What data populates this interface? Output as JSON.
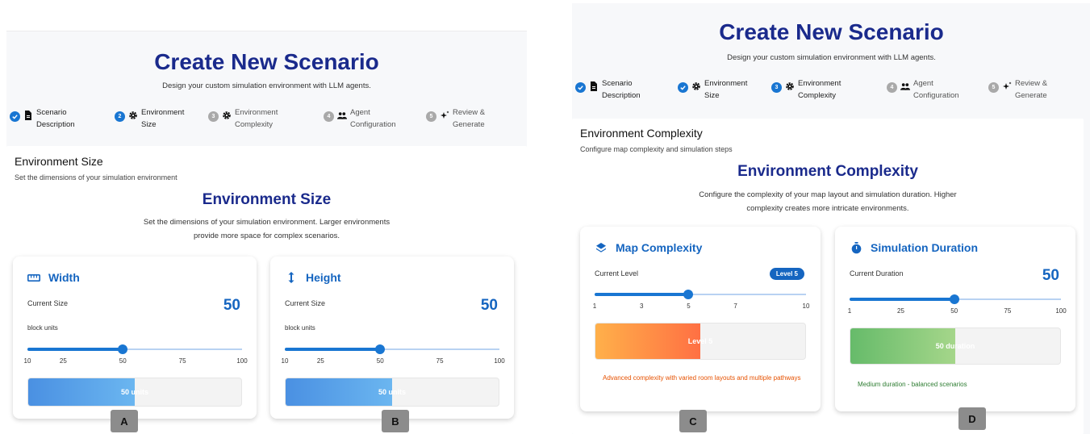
{
  "left": {
    "title": "Create New Scenario",
    "subtitle": "Design your custom simulation environment with LLM agents.",
    "steps": [
      {
        "num": "1",
        "line1": "Scenario",
        "line2": "Description",
        "state": "done",
        "icon": "document-icon"
      },
      {
        "num": "2",
        "line1": "Environment",
        "line2": "Size",
        "state": "active",
        "icon": "gear-icon"
      },
      {
        "num": "3",
        "line1": "Environment",
        "line2": "Complexity",
        "state": "todo",
        "icon": "gear-icon"
      },
      {
        "num": "4",
        "line1": "Agent",
        "line2": "Configuration",
        "state": "todo",
        "icon": "people-icon"
      },
      {
        "num": "5",
        "line1": "Review &",
        "line2": "Generate",
        "state": "todo",
        "icon": "sparkle-icon"
      }
    ],
    "section": {
      "title": "Environment Size",
      "subtitle": "Set the dimensions of your simulation environment"
    },
    "heading": "Environment Size",
    "desc1": "Set the dimensions of your simulation environment. Larger environments",
    "desc2": "provide more space for complex scenarios.",
    "width": {
      "title": "Width",
      "label": "Current Size",
      "value": "50",
      "unit": "block units",
      "slider": {
        "min": 10,
        "max": 100,
        "value": 50
      },
      "ticks": [
        "10",
        "25",
        "50",
        "75",
        "100"
      ],
      "bar_text": "50 units",
      "bar_fraction": 0.5
    },
    "height": {
      "title": "Height",
      "label": "Current Size",
      "value": "50",
      "unit": "block units",
      "slider": {
        "min": 10,
        "max": 100,
        "value": 50
      },
      "ticks": [
        "10",
        "25",
        "50",
        "75",
        "100"
      ],
      "bar_text": "50 units",
      "bar_fraction": 0.5
    }
  },
  "right": {
    "title": "Create New Scenario",
    "subtitle": "Design your custom simulation environment with LLM agents.",
    "steps": [
      {
        "num": "1",
        "line1": "Scenario",
        "line2": "Description",
        "state": "done",
        "icon": "document-icon"
      },
      {
        "num": "2",
        "line1": "Environment",
        "line2": "Size",
        "state": "done",
        "icon": "gear-icon"
      },
      {
        "num": "3",
        "line1": "Environment",
        "line2": "Complexity",
        "state": "active",
        "icon": "gear-icon"
      },
      {
        "num": "4",
        "line1": "Agent",
        "line2": "Configuration",
        "state": "todo",
        "icon": "people-icon"
      },
      {
        "num": "5",
        "line1": "Review &",
        "line2": "Generate",
        "state": "todo",
        "icon": "sparkle-icon"
      }
    ],
    "section": {
      "title": "Environment Complexity",
      "subtitle": "Configure map complexity and simulation steps"
    },
    "heading": "Environment Complexity",
    "desc1": "Configure the complexity of your map layout and simulation duration. Higher",
    "desc2": "complexity creates more intricate environments.",
    "map": {
      "title": "Map Complexity",
      "label": "Current Level",
      "badge": "Level 5",
      "slider": {
        "min": 1,
        "max": 10,
        "value": 5
      },
      "ticks": [
        "1",
        "3",
        "5",
        "7",
        "10"
      ],
      "bar_text": "Level 5",
      "bar_fraction": 0.5,
      "note": "Advanced complexity with varied room layouts and multiple pathways",
      "note_color": "#e65100"
    },
    "duration": {
      "title": "Simulation Duration",
      "label": "Current Duration",
      "value": "50",
      "slider": {
        "min": 1,
        "max": 100,
        "value": 50
      },
      "ticks": [
        "1",
        "25",
        "50",
        "75",
        "100"
      ],
      "bar_text": "50 duration",
      "bar_fraction": 0.5,
      "note": "Medium duration - balanced scenarios",
      "note_color": "#2e7d32"
    }
  },
  "tags": {
    "a": "A",
    "b": "B",
    "c": "C",
    "d": "D"
  },
  "colors": {
    "accent": "#1976d2",
    "title": "#1a2a8c",
    "blue_grad": [
      "#4a90e2",
      "#6bb6f0"
    ],
    "orange_grad": [
      "#ffb04a",
      "#ff7043"
    ],
    "green_grad": [
      "#66bb6a",
      "#a5d68a"
    ]
  }
}
